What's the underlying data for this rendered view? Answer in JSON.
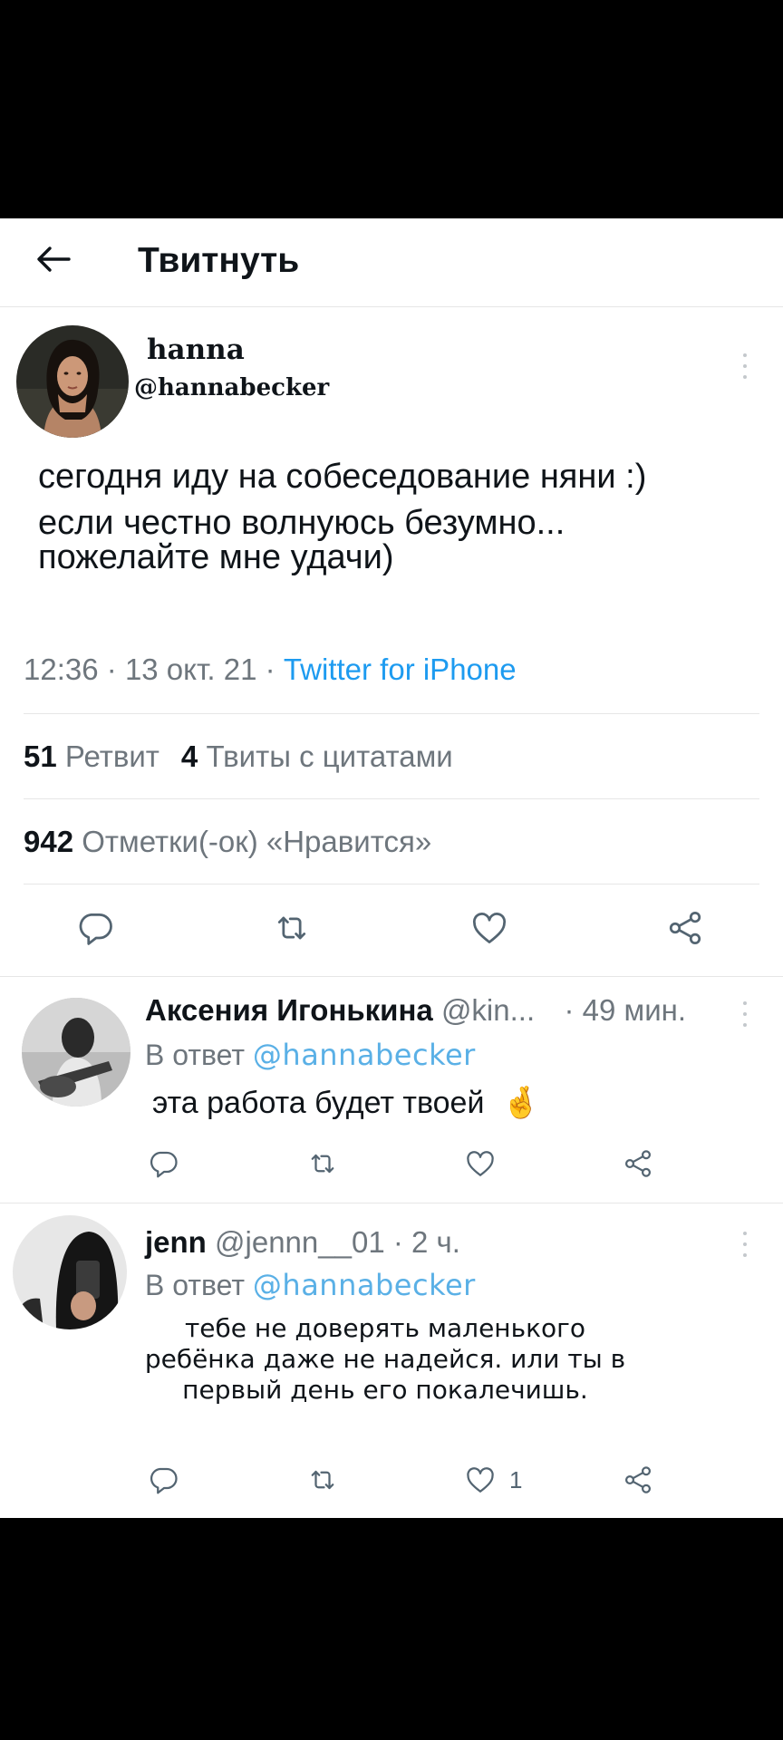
{
  "header": {
    "title": "Твитнуть"
  },
  "tweet": {
    "name": "hanna",
    "handle": "@hannabecker",
    "text_lines": [
      "сегодня иду на собеседование няни :)",
      "если честно волнуюсь безумно...",
      "пожелайте мне удачи)"
    ],
    "time": "12:36",
    "date": "13 окт. 21",
    "source": "Twitter for iPhone",
    "retweets_count": "51",
    "retweets_label": "Ретвит",
    "quotes_count": "4",
    "quotes_label": "Твиты с цитатами",
    "likes_count": "942",
    "likes_label": "Отметки(-ок) «Нравится»"
  },
  "replies": [
    {
      "name": "Аксения Игонькина",
      "handle": "@kin...",
      "time": "· 49 мин.",
      "reply_to_label": "В ответ",
      "reply_to_handle": "@hannabecker",
      "text": "эта работа будет твоей",
      "emoji": "🤞"
    },
    {
      "name": "jenn",
      "handle": "@jennn__01",
      "time": "· 2 ч.",
      "reply_to_label": "В ответ",
      "reply_to_handle": "@hannabecker",
      "text_lines": [
        "тебе не доверять маленького",
        "ребёнка даже не надейся. или ты в",
        "первый день его покалечишь."
      ],
      "like_count": "1"
    }
  ],
  "icons": {
    "back": "arrow-left-icon",
    "more": "more-vertical-icon",
    "reply": "reply-icon",
    "retweet": "retweet-icon",
    "like": "heart-icon",
    "share": "share-icon"
  },
  "colors": {
    "link": "#1d9bf0",
    "mention": "#5ab0e6",
    "secondary_text": "#6e767d",
    "icon": "#536471"
  }
}
